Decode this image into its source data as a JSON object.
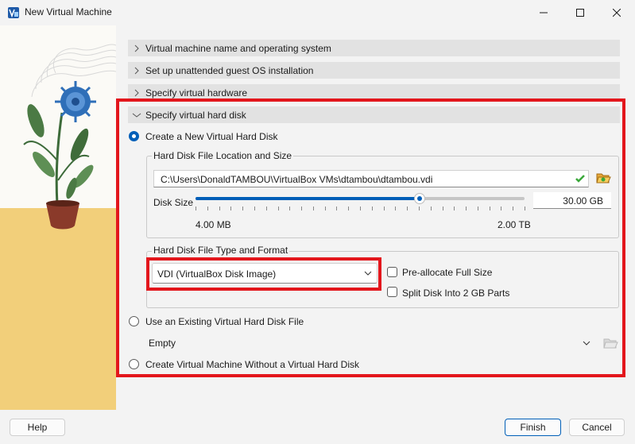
{
  "window": {
    "title": "New Virtual Machine"
  },
  "sections": [
    {
      "label": "Virtual machine name and operating system",
      "expanded": false
    },
    {
      "label": "Set up unattended guest OS installation",
      "expanded": false
    },
    {
      "label": "Specify virtual hardware",
      "expanded": false
    },
    {
      "label": "Specify virtual hard disk",
      "expanded": true
    }
  ],
  "hard_disk": {
    "create_new_label": "Create a New Virtual Hard Disk",
    "location_group_title": "Hard Disk File Location and Size",
    "file_path": "C:\\Users\\DonaldTAMBOU\\VirtualBox VMs\\dtambou\\dtambou.vdi",
    "disk_size_label": "Disk Size",
    "disk_size_value": "30.00 GB",
    "slider_fraction": 0.68,
    "slider_min_label": "4.00 MB",
    "slider_max_label": "2.00 TB",
    "format_group_title": "Hard Disk File Type and Format",
    "format_selected": "VDI (VirtualBox Disk Image)",
    "preallocate_label": "Pre-allocate Full Size",
    "split_label": "Split Disk Into 2 GB Parts",
    "use_existing_label": "Use an Existing Virtual Hard Disk File",
    "existing_selected": "Empty",
    "no_disk_label": "Create Virtual Machine Without a Virtual Hard Disk"
  },
  "footer": {
    "help_label": "Help",
    "finish_label": "Finish",
    "cancel_label": "Cancel"
  },
  "colors": {
    "accent": "#005fb8",
    "highlight": "#e3161c",
    "check_ok": "#3aa83a"
  }
}
